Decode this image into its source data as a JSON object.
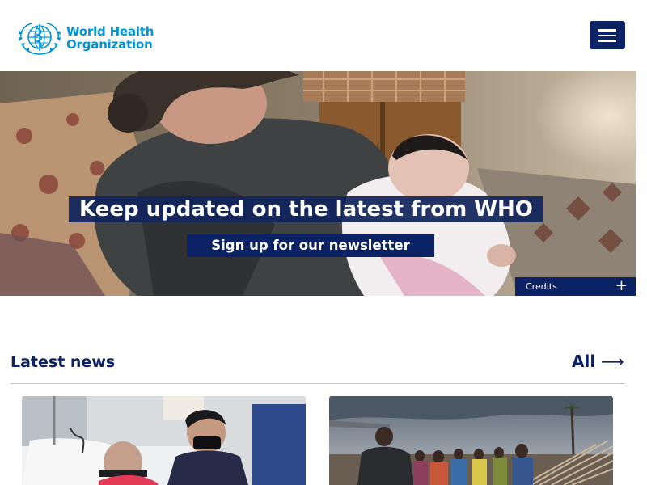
{
  "brand": {
    "name_line1": "World Health",
    "name_line2": "Organization",
    "color": "#0093d5"
  },
  "header": {
    "menu_icon": "hamburger-menu-icon",
    "accent": "#0b2265"
  },
  "hero": {
    "title": "Keep updated on the latest from WHO",
    "cta_label": "Sign up for our newsletter",
    "credits_label": "Credits",
    "credits_icon": "+"
  },
  "latest_news": {
    "heading": "Latest news",
    "all_label": "All",
    "all_icon": "⟶",
    "cards": [
      {
        "image": "hospital-photo"
      },
      {
        "image": "crowd-photo"
      }
    ]
  },
  "scrollbar": {
    "up_icon": "scroll-up-arrow-icon",
    "down_icon": "scroll-down-arrow-icon"
  }
}
